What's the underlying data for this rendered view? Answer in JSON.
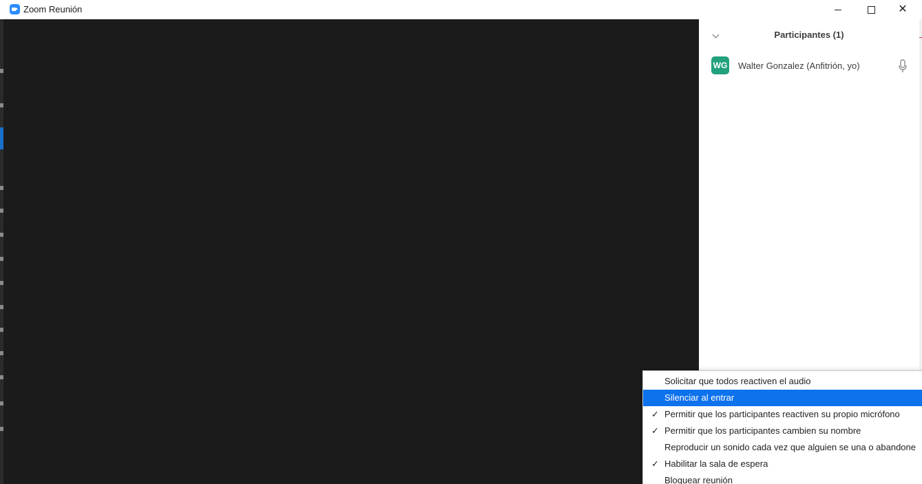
{
  "window": {
    "title": "Zoom Reunión",
    "controls": {
      "minimize": "minimize-icon",
      "maximize": "maximize-icon",
      "close": "close-icon"
    }
  },
  "participants_panel": {
    "title": "Participantes (1)",
    "participants": [
      {
        "initials": "WG",
        "name": "Walter Gonzalez (Anfitrión, yo)",
        "avatar_color": "#23a17e",
        "mic_icon": "microphone-icon"
      }
    ]
  },
  "context_menu": {
    "items": [
      {
        "label": "Solicitar que todos reactiven el audio",
        "checked": false,
        "highlighted": false
      },
      {
        "label": "Silenciar al entrar",
        "checked": false,
        "highlighted": true
      },
      {
        "label": "Permitir que los participantes reactiven su propio micrófono",
        "checked": true,
        "highlighted": false
      },
      {
        "label": "Permitir que los participantes cambien su nombre",
        "checked": true,
        "highlighted": false
      },
      {
        "label": "Reproducir un sonido cada vez que alguien se una o abandone",
        "checked": false,
        "highlighted": false
      },
      {
        "label": "Habilitar la sala de espera",
        "checked": true,
        "highlighted": false
      },
      {
        "label": "Bloquear reunión",
        "checked": false,
        "highlighted": false
      }
    ],
    "check_glyph": "✓"
  },
  "colors": {
    "accent": "#2d8cff",
    "menu_highlight": "#0e72ed",
    "video_background": "#1b1b1b"
  }
}
